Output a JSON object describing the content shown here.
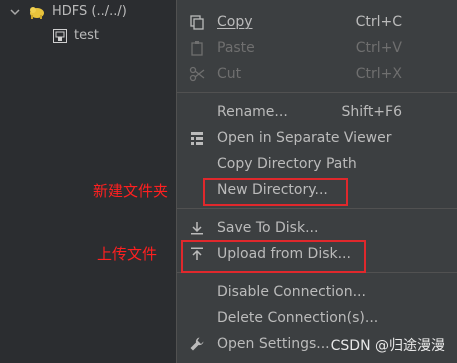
{
  "tree": {
    "root_label": "HDFS (../../)",
    "child_label": "test"
  },
  "menu": {
    "items": [
      {
        "label": "Copy",
        "shortcut": "Ctrl+C",
        "icon": "copy-icon"
      },
      {
        "label": "Paste",
        "shortcut": "Ctrl+V",
        "icon": "paste-icon"
      },
      {
        "label": "Cut",
        "shortcut": "Ctrl+X",
        "icon": "cut-icon"
      },
      {
        "label": "Rename...",
        "shortcut": "Shift+F6"
      },
      {
        "label": "Open in Separate Viewer",
        "icon": "viewer-icon"
      },
      {
        "label": "Copy Directory Path"
      },
      {
        "label": "New Directory..."
      },
      {
        "label": "Save To Disk...",
        "icon": "download-icon"
      },
      {
        "label": "Upload from Disk...",
        "icon": "upload-icon"
      },
      {
        "label": "Disable Connection..."
      },
      {
        "label": "Delete Connection(s)..."
      },
      {
        "label": "Open Settings...",
        "icon": "wrench-icon"
      }
    ]
  },
  "annotations": {
    "new_dir": "新建文件夹",
    "upload": "上传文件"
  },
  "watermark": "CSDN @归途漫漫",
  "colors": {
    "highlight_red": "#e0282c",
    "annotation_red": "#ff2020",
    "menu_bg": "#3c3f41"
  }
}
